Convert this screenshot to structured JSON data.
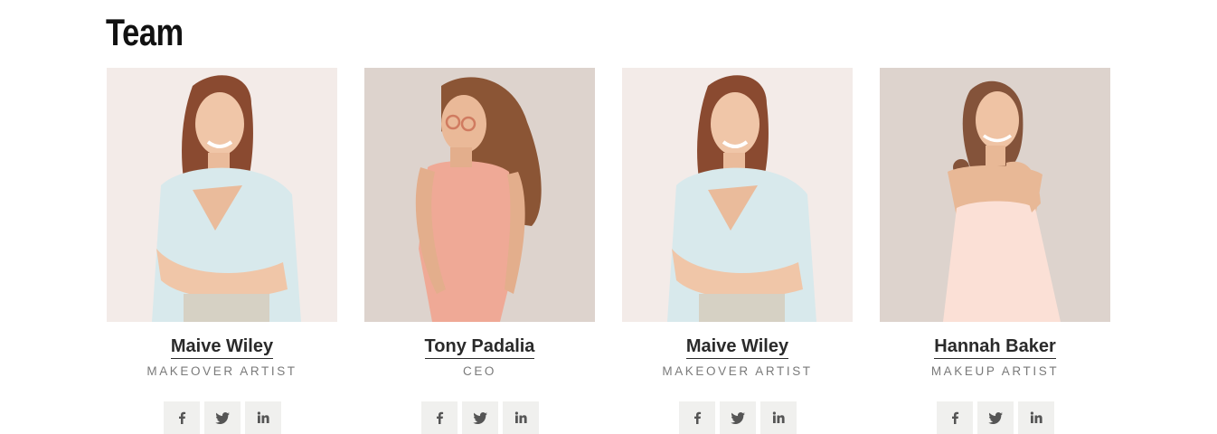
{
  "section": {
    "title": "Team"
  },
  "members": [
    {
      "name": "Maive Wiley",
      "role": "MAKEOVER ARTIST",
      "outfit": "light-blue shirt",
      "bg": "#f3ebe8"
    },
    {
      "name": "Tony Padalia",
      "role": "CEO",
      "outfit": "peach slip dress",
      "bg": "#ddd3cd"
    },
    {
      "name": "Maive Wiley",
      "role": "MAKEOVER ARTIST",
      "outfit": "light-blue shirt",
      "bg": "#f3ebe8"
    },
    {
      "name": "Hannah Baker",
      "role": "MAKEUP ARTIST",
      "outfit": "pale pink dress",
      "bg": "#ddd3cd"
    }
  ],
  "social_icons": [
    "facebook-icon",
    "twitter-icon",
    "linkedin-icon"
  ],
  "colors": {
    "icon_bg": "#f0f0ee",
    "icon_fg": "#555555",
    "name": "#2a2a2a",
    "role": "#7a7a7a"
  }
}
